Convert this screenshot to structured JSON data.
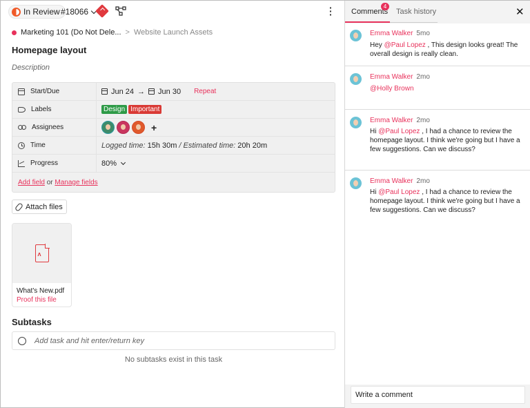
{
  "header": {
    "status_label": "In Review",
    "task_id": "#18066",
    "priority_icon": "priority-up-icon",
    "flow_icon": "workflow-icon",
    "more_icon": "more-vert-icon"
  },
  "breadcrumb": {
    "project": "Marketing 101 (Do Not Dele...",
    "separator": ">",
    "list": "Website Launch Assets"
  },
  "task": {
    "title": "Homepage layout",
    "description_placeholder": "Description"
  },
  "fields": {
    "start_due": {
      "label": "Start/Due",
      "start": "Jun 24",
      "arrow": "→",
      "due": "Jun 30",
      "repeat": "Repeat"
    },
    "labels": {
      "label": "Labels",
      "items": [
        "Design",
        "Important"
      ]
    },
    "assignees": {
      "label": "Assignees",
      "add": "+"
    },
    "time": {
      "label": "Time",
      "logged_label": "Logged time:",
      "logged_value": "15h 30m",
      "sep": "/",
      "estimated_label": "Estimated time:",
      "estimated_value": "20h 20m"
    },
    "progress": {
      "label": "Progress",
      "value": "80%"
    },
    "add_field": "Add field",
    "or": "or",
    "manage_fields": "Manage fields"
  },
  "attachments": {
    "attach_label": "Attach files",
    "file": {
      "name": "What's New.pdf",
      "action": "Proof this file"
    }
  },
  "subtasks": {
    "heading": "Subtasks",
    "placeholder": "Add task and hit enter/return key",
    "empty": "No subtasks exist in this task"
  },
  "sidebar": {
    "tabs": [
      "Comments",
      "Task history"
    ],
    "comments_badge": "4",
    "close": "✕",
    "comments": [
      {
        "author": "Emma Walker",
        "time": "5mo",
        "pre": "Hey ",
        "mention": "@Paul Lopez",
        "post": " , This design looks great! The overall design is really clean."
      },
      {
        "author": "Emma Walker",
        "time": "2mo",
        "pre": "",
        "mention": "@Holly Brown",
        "post": ""
      },
      {
        "author": "Emma Walker",
        "time": "2mo",
        "pre": "Hi ",
        "mention": "@Paul Lopez",
        "post": " , I had a chance to review the homepage layout. I think we're going but I have a few suggestions. Can we discuss?"
      },
      {
        "author": "Emma Walker",
        "time": "2mo",
        "pre": "Hi ",
        "mention": "@Paul Lopez",
        "post": " , I had a chance to review the homepage layout. I think we're going but I have a few suggestions. Can we discuss?"
      }
    ],
    "comment_placeholder": "Write a comment"
  },
  "colors": {
    "accent": "#e8315b",
    "status_orange": "#f05a28",
    "tag_design": "#2e9a47",
    "tag_important": "#d93a35"
  }
}
